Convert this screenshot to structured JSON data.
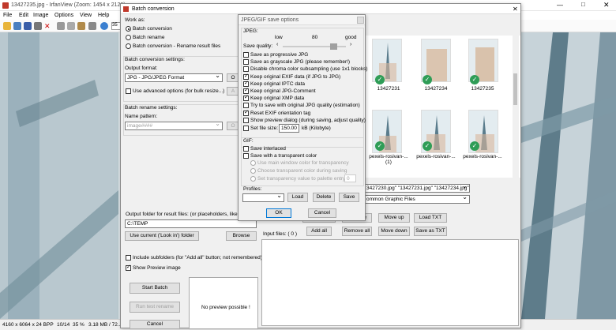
{
  "main": {
    "title": "13427235.jpg - IrfanView (Zoom: 1454 x 2120)",
    "menus": [
      "File",
      "Edit",
      "Image",
      "Options",
      "View",
      "Help"
    ],
    "status": {
      "dims": "4160 x 6064 x 24 BPP",
      "index": "10/14",
      "zoom": "35 %",
      "size": "3.18 MB / 72..."
    }
  },
  "batch": {
    "title": "Batch conversion",
    "work_as": "Work as:",
    "modes": [
      "Batch conversion",
      "Batch rename",
      "Batch conversion - Rename result files"
    ],
    "settings_label": "Batch conversion settings:",
    "output_format_label": "Output format:",
    "output_format_value": "JPG - JPG/JPEG Format",
    "options_btn": "O",
    "advanced_label": "Use advanced options (for bulk resize...)",
    "advanced_btn": "A",
    "rename_label": "Batch rename settings:",
    "name_pattern_label": "Name pattern:",
    "name_pattern_value": "image####",
    "output_folder_label": "Output folder for result files: (or placeholders, like: $D",
    "output_folder_value": "C:\\TEMP",
    "use_current_btn": "Use current ('Look in') folder",
    "browse_btn": "Browse",
    "include_subfolders": "Include subfolders (for \"Add all\" button; not remembered)",
    "show_preview": "Show Preview image",
    "start_btn": "Start Batch",
    "test_rename_btn": "Run test rename",
    "cancel_btn": "Cancel",
    "no_preview": "No preview possible !",
    "filenames_value": "3427230.jpg\" \"13427231.jpg\" \"13427234.jpg\"",
    "filetype_value": "ommon Graphic Files",
    "add_btn": "Add",
    "add_all_btn": "Add all",
    "remove_btn": "Remove",
    "remove_all_btn": "Remove all",
    "move_up_btn": "Move up",
    "move_down_btn": "Move down",
    "load_txt_btn": "Load TXT",
    "save_txt_btn": "Save as TXT",
    "input_files_label": "Input files: ( 0 )",
    "thumbs": [
      "13427231",
      "13427234",
      "13427235",
      "pexels-rosivan-...\n(1)",
      "pexels-rosivan-...",
      "pexels-rosivan-..."
    ]
  },
  "jpg": {
    "title": "JPEG/GIF save options",
    "jpeg_label": "JPEG:",
    "low": "low",
    "quality_value": "80",
    "good": "good",
    "save_quality": "Save quality:",
    "options": [
      {
        "label": "Save as progressive JPG",
        "checked": false
      },
      {
        "label": "Save as grayscale JPG (please remember!)",
        "checked": false
      },
      {
        "label": "Disable chroma color subsampling (use 1x1 blocks)",
        "checked": false
      },
      {
        "label": "Keep original EXIF data (if JPG to JPG)",
        "checked": true
      },
      {
        "label": "Keep original IPTC data",
        "checked": true
      },
      {
        "label": "Keep original JPG-Comment",
        "checked": true
      },
      {
        "label": "Keep original XMP data",
        "checked": true
      },
      {
        "label": "Try to save with original JPG quality (estimation)",
        "checked": false
      },
      {
        "label": "Reset EXIF orientation tag",
        "checked": true
      },
      {
        "label": "Show preview dialog (during saving, adjust quality)",
        "checked": false
      }
    ],
    "set_file_size": "Set file size:",
    "file_size_value": "150.00",
    "file_size_unit": "kB (Kilobyte)",
    "gif_label": "GIF:",
    "save_interlaced": "Save interlaced",
    "save_transparent": "Save with a transparent color",
    "use_main_window": "Use main window color for transparency",
    "choose_transparent": "Choose transparent color during saving",
    "set_transparency": "Set transparency value to palette entry:",
    "palette_value": "0",
    "profiles_label": "Profiles:",
    "load_btn": "Load",
    "delete_btn": "Delete",
    "save_btn": "Save",
    "ok_btn": "OK",
    "cancel_btn": "Cancel"
  }
}
